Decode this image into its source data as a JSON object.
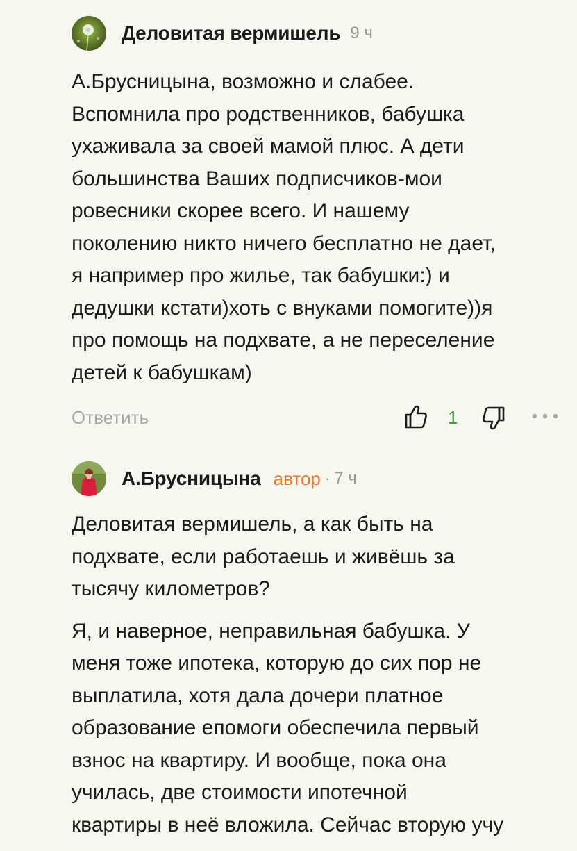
{
  "comments": [
    {
      "author": "Деловитая вермишель",
      "time": "9 ч",
      "avatar_icon": "dandelion-avatar",
      "paragraphs": [
        [
          "А.Брусницына, возможно и слабее.",
          "Вспомнила про родственников, бабушка",
          "ухаживала за своей мамой плюс. А дети",
          "большинства Ваших подписчиков-мои",
          "ровесники скорее всего. И нашему",
          "поколению никто ничего бесплатно не дает,",
          "я например про жилье, так бабушки:) и",
          "дедушки кстати)хоть с внуками помогите))я",
          "про помощь на подхвате, а не переселение",
          "детей к бабушкам)"
        ]
      ],
      "actions": {
        "reply_label": "Ответить",
        "like_count": "1",
        "like_icon": "thumbs-up-icon",
        "dislike_icon": "thumbs-down-icon",
        "more_icon": "more-dots-icon"
      }
    },
    {
      "author": "А.Брусницына",
      "badge": "автор",
      "separator": "·",
      "time": "7 ч",
      "avatar_icon": "woman-photo-avatar",
      "paragraphs": [
        [
          "Деловитая вермишель, а как быть на",
          "подхвате, если работаешь и живёшь за",
          "тысячу километров?"
        ],
        [
          "Я, и наверное, неправильная бабушка. У",
          "меня тоже ипотека, которую до сих пор не",
          "выплатила, хотя дала дочери платное",
          "образование епомоги обеспечила первый",
          "взнос на квартиру. И вообще, пока она",
          "училась, две стоимости ипотечной",
          "квартиры в неё вложила. Сейчас вторую учу"
        ]
      ]
    }
  ],
  "colors": {
    "background": "#f7f7ef",
    "text": "#1b1b1b",
    "muted": "#9a9a9a",
    "author_badge": "#e8772a",
    "like_count": "#3aa53a"
  }
}
